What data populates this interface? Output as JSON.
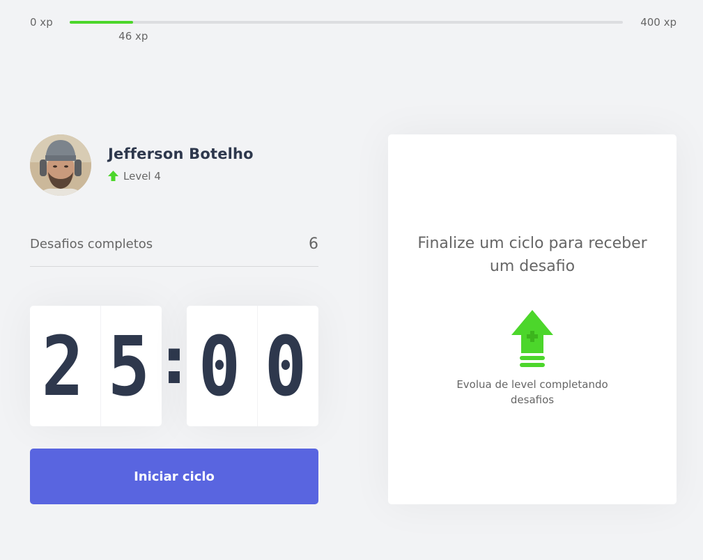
{
  "xp": {
    "min_label": "0 xp",
    "max_label": "400 xp",
    "current_label": "46 xp",
    "current": 46,
    "max": 400,
    "fill_color": "#4cd62b"
  },
  "profile": {
    "name": "Jefferson Botelho",
    "level_label": "Level 4",
    "level_icon": "level-up-arrow-icon"
  },
  "completed_challenges": {
    "label": "Desafios completos",
    "value": "6"
  },
  "countdown": {
    "minute_left": "2",
    "minute_right": "5",
    "separator": ":",
    "second_left": "0",
    "second_right": "0"
  },
  "start_button": {
    "label": "Iniciar ciclo",
    "color": "#5965e0"
  },
  "challenge_box": {
    "title": "Finalize um ciclo para receber um desafio",
    "hint": "Evolua de level completando desafios",
    "icon": "level-up-icon"
  }
}
